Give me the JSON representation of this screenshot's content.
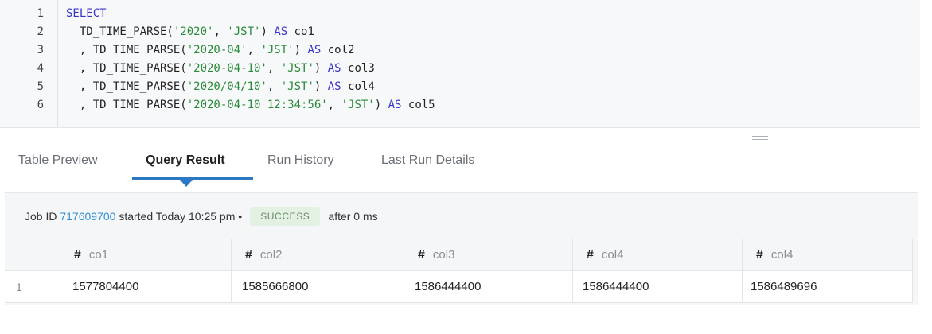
{
  "editor": {
    "lines": [
      {
        "num": "1",
        "parts": [
          {
            "t": "SELECT",
            "c": "kw"
          }
        ]
      },
      {
        "num": "2",
        "parts": [
          {
            "t": "  TD_TIME_PARSE(",
            "c": ""
          },
          {
            "t": "'2020'",
            "c": "str"
          },
          {
            "t": ", ",
            "c": ""
          },
          {
            "t": "'JST'",
            "c": "str"
          },
          {
            "t": ") ",
            "c": ""
          },
          {
            "t": "AS",
            "c": "kw"
          },
          {
            "t": " co1",
            "c": ""
          }
        ]
      },
      {
        "num": "3",
        "parts": [
          {
            "t": "  , TD_TIME_PARSE(",
            "c": ""
          },
          {
            "t": "'2020-04'",
            "c": "str"
          },
          {
            "t": ", ",
            "c": ""
          },
          {
            "t": "'JST'",
            "c": "str"
          },
          {
            "t": ") ",
            "c": ""
          },
          {
            "t": "AS",
            "c": "kw"
          },
          {
            "t": " col2",
            "c": ""
          }
        ]
      },
      {
        "num": "4",
        "parts": [
          {
            "t": "  , TD_TIME_PARSE(",
            "c": ""
          },
          {
            "t": "'2020-04-10'",
            "c": "str"
          },
          {
            "t": ", ",
            "c": ""
          },
          {
            "t": "'JST'",
            "c": "str"
          },
          {
            "t": ") ",
            "c": ""
          },
          {
            "t": "AS",
            "c": "kw"
          },
          {
            "t": " col3",
            "c": ""
          }
        ]
      },
      {
        "num": "5",
        "parts": [
          {
            "t": "  , TD_TIME_PARSE(",
            "c": ""
          },
          {
            "t": "'2020/04/10'",
            "c": "str"
          },
          {
            "t": ", ",
            "c": ""
          },
          {
            "t": "'JST'",
            "c": "str"
          },
          {
            "t": ") ",
            "c": ""
          },
          {
            "t": "AS",
            "c": "kw"
          },
          {
            "t": " col4",
            "c": ""
          }
        ]
      },
      {
        "num": "6",
        "parts": [
          {
            "t": "  , TD_TIME_PARSE(",
            "c": ""
          },
          {
            "t": "'2020-04-10 12:34:56'",
            "c": "str"
          },
          {
            "t": ", ",
            "c": ""
          },
          {
            "t": "'JST'",
            "c": "str"
          },
          {
            "t": ") ",
            "c": ""
          },
          {
            "t": "AS",
            "c": "kw"
          },
          {
            "t": " col5",
            "c": ""
          }
        ]
      }
    ]
  },
  "tabs": {
    "table_preview": "Table Preview",
    "query_result": "Query Result",
    "run_history": "Run History",
    "last_run_details": "Last Run Details"
  },
  "status": {
    "prefix": "Job ID",
    "job_id": "717609700",
    "started": "started Today 10:25 pm •",
    "badge": "SUCCESS",
    "duration": "after 0 ms"
  },
  "table": {
    "type_icon": "#",
    "headers": [
      "co1",
      "col2",
      "col3",
      "col4",
      "col4"
    ],
    "rows": [
      {
        "index": "1",
        "values": [
          "1577804400",
          "1585666800",
          "1586444400",
          "1586444400",
          "1586489696"
        ]
      }
    ]
  },
  "colors": {
    "keyword": "#3a35c9",
    "string": "#2a8a3a",
    "accent": "#2b78c5",
    "link": "#2f8fd0",
    "success_bg": "#e2f1e1"
  }
}
